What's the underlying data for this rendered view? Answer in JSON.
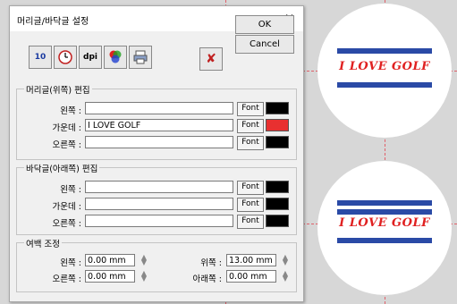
{
  "dialog": {
    "title": "머리글/바닥글 설정",
    "close_symbol": "×",
    "ok_label": "OK",
    "cancel_label": "Cancel",
    "toolbar": {
      "calendar_day": "10",
      "dpi_label": "dpi",
      "delete_symbol": "✘"
    },
    "header_group": {
      "title": "머리글(위쪽) 편집",
      "rows": [
        {
          "label": "왼쪽 :",
          "value": "",
          "font_label": "Font",
          "color": "#000000"
        },
        {
          "label": "가운데 :",
          "value": "I LOVE GOLF",
          "font_label": "Font",
          "color": "#e83030"
        },
        {
          "label": "오른쪽 :",
          "value": "",
          "font_label": "Font",
          "color": "#000000"
        }
      ]
    },
    "footer_group": {
      "title": "바닥글(아래쪽) 편집",
      "rows": [
        {
          "label": "왼쪽 :",
          "value": "",
          "font_label": "Font",
          "color": "#000000"
        },
        {
          "label": "가운데 :",
          "value": "",
          "font_label": "Font",
          "color": "#000000"
        },
        {
          "label": "오른쪽 :",
          "value": "",
          "font_label": "Font",
          "color": "#000000"
        }
      ]
    },
    "margin_group": {
      "title": "여백 조정",
      "left_label": "왼쪽 :",
      "left_value": "0.00 mm",
      "right_label": "오른쪽 :",
      "right_value": "0.00 mm",
      "top_label": "위쪽 :",
      "top_value": "13.00 mm",
      "bottom_label": "아래쪽 :",
      "bottom_value": "0.00 mm"
    }
  },
  "preview": {
    "text_top": "I LOVE GOLF",
    "text_bottom": "I LOVE GOLF",
    "stripe_color": "#2a4aa6",
    "text_color": "#e02020"
  }
}
